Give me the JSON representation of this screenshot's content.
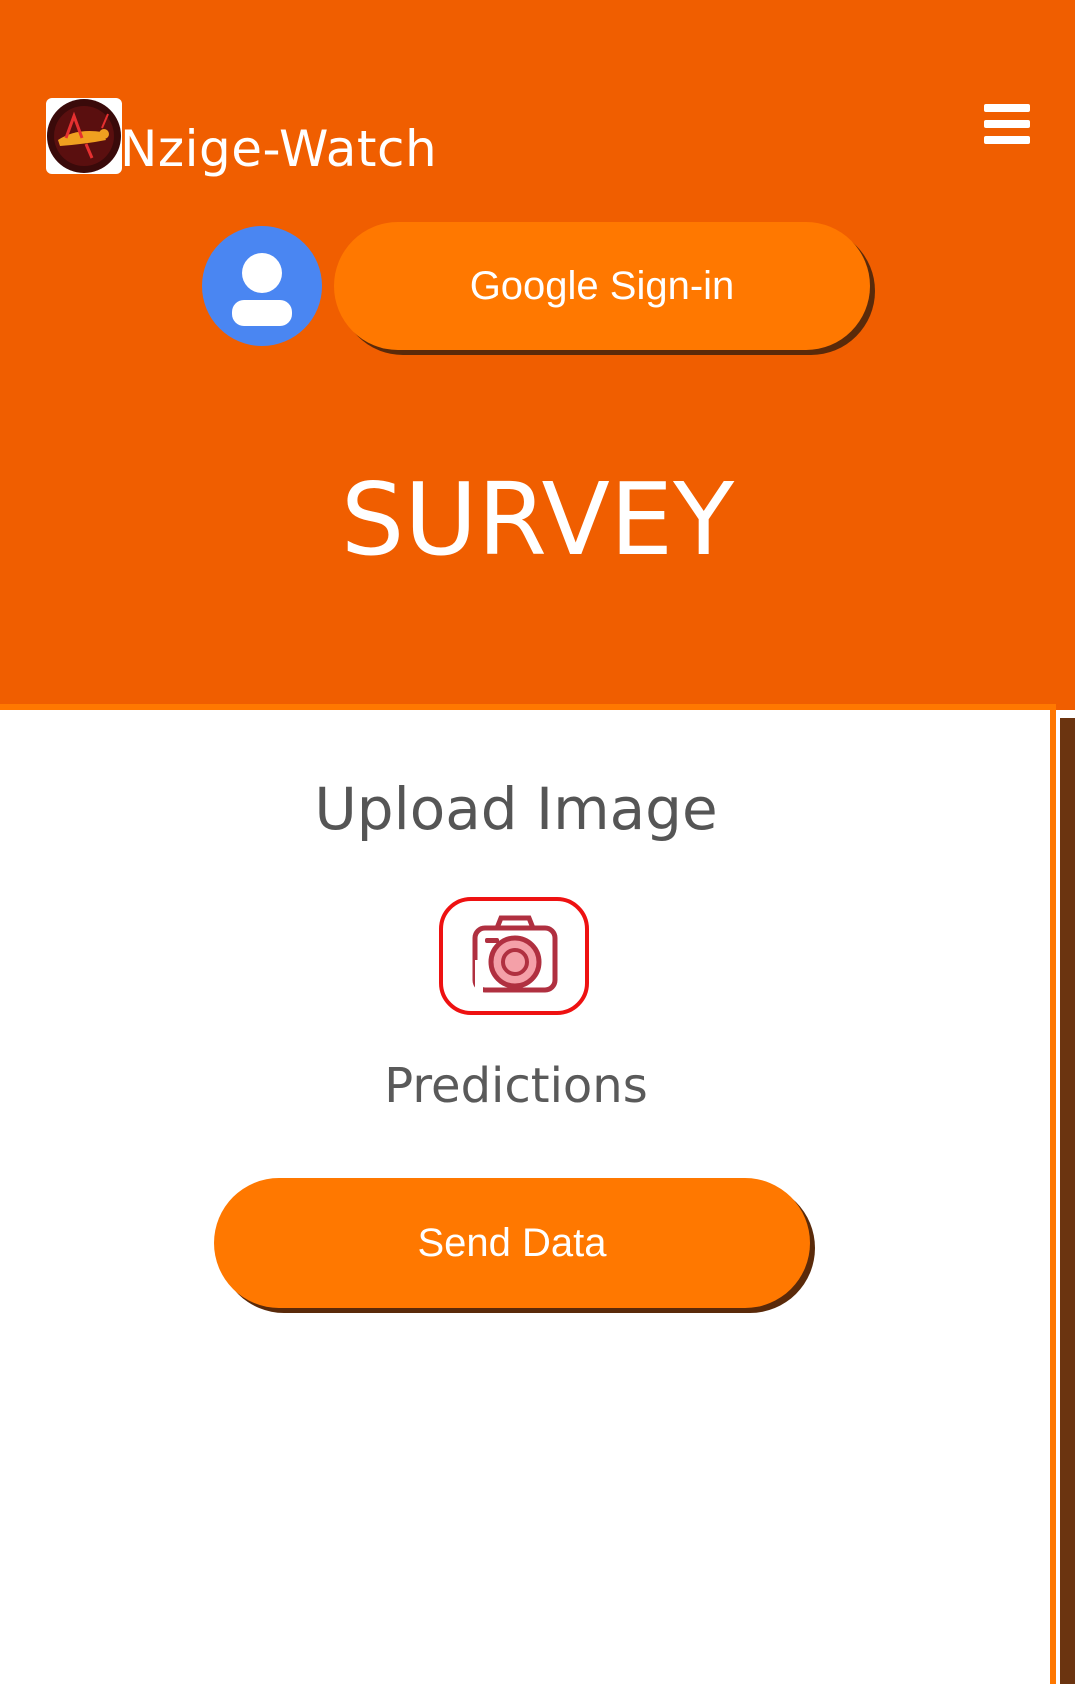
{
  "header": {
    "app_title": "Nzige-Watch",
    "logo_icon": "locust-logo-icon",
    "menu_icon": "hamburger-menu-icon",
    "avatar_icon": "user-avatar-icon",
    "signin_label": "Google Sign-in"
  },
  "hero": {
    "title": "SURVEY"
  },
  "card": {
    "upload_title": "Upload Image",
    "camera_icon": "camera-icon",
    "predictions_label": "Predictions",
    "send_label": "Send Data"
  },
  "colors": {
    "header_bg": "#f05e00",
    "button_bg": "#ff7800",
    "button_shadow": "#5a2a0a",
    "avatar_bg": "#4a86f2",
    "camera_border": "#ee1111"
  }
}
